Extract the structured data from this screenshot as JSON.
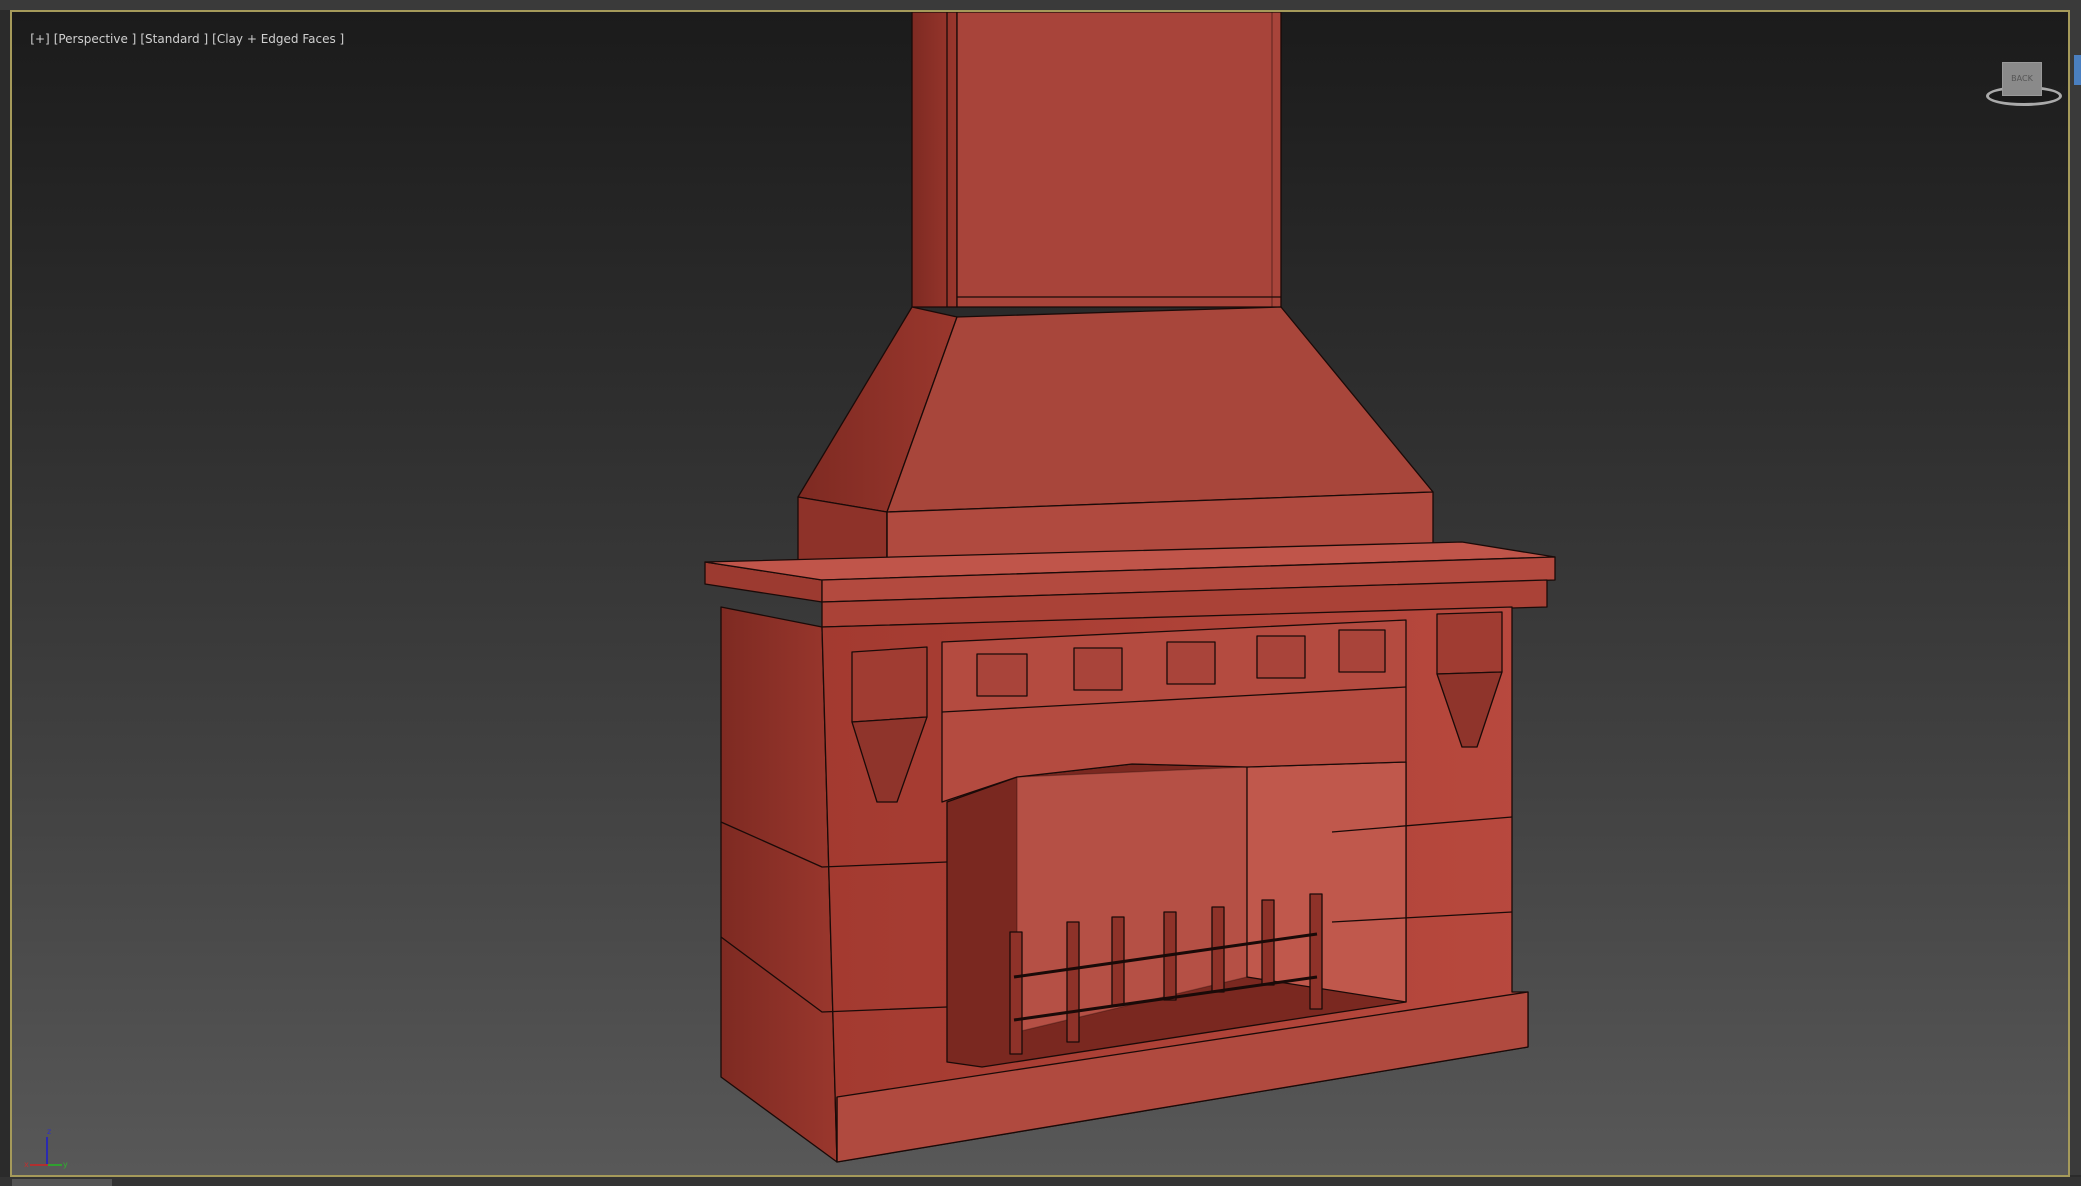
{
  "viewport": {
    "label_parts": [
      "[+]",
      "[Perspective ]",
      "[Standard ]",
      "[Clay + Edged Faces ]"
    ]
  },
  "viewcube": {
    "face_label": "BACK"
  },
  "axis_gizmo": {
    "x": "x",
    "y": "y",
    "z": "z"
  },
  "colors": {
    "clay": "#b5463b",
    "edge": "#1a0a08",
    "border": "#a59a5a"
  }
}
